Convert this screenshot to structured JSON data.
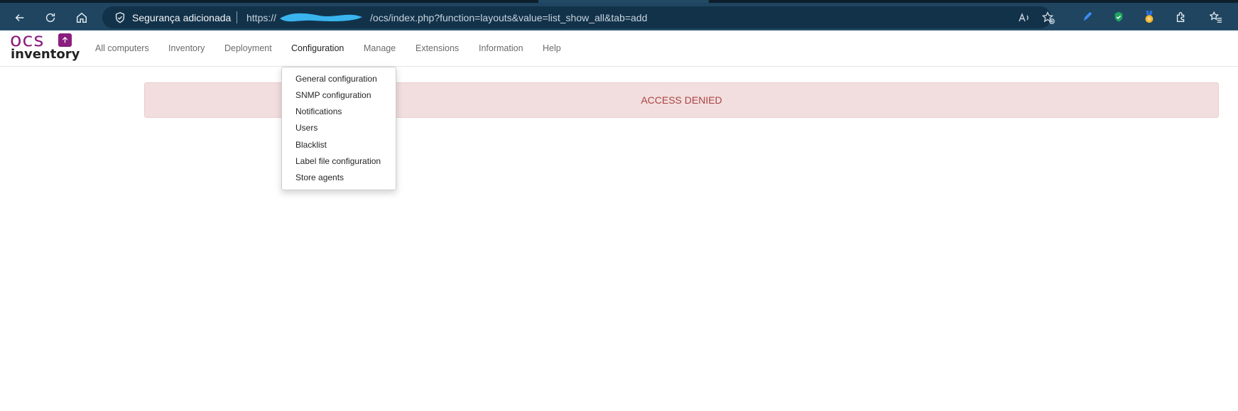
{
  "browser": {
    "security_label": "Segurança adicionada",
    "url_prefix": "https://",
    "url_path": "/ocs/index.php?function=layouts&value=list_show_all&tab=add",
    "icons": [
      "back-icon",
      "refresh-icon",
      "home-icon",
      "shield-icon",
      "read-aloud-icon",
      "favorite-add-icon",
      "pen-extension-icon",
      "shield-check-extension-icon",
      "medal-extension-icon",
      "extensions-icon",
      "favorites-icon"
    ]
  },
  "app": {
    "logo_top": "ocs",
    "logo_bottom": "inventory",
    "brand_color": "#8a1d7e"
  },
  "nav": {
    "items": [
      "All computers",
      "Inventory",
      "Deployment",
      "Configuration",
      "Manage",
      "Extensions",
      "Information",
      "Help"
    ],
    "active": "Configuration"
  },
  "dropdown": {
    "items": [
      "General configuration",
      "SNMP configuration",
      "Notifications",
      "Users",
      "Blacklist",
      "Label file configuration",
      "Store agents"
    ]
  },
  "alert": {
    "text": "ACCESS DENIED",
    "background": "#f2dede",
    "color": "#a94442"
  }
}
